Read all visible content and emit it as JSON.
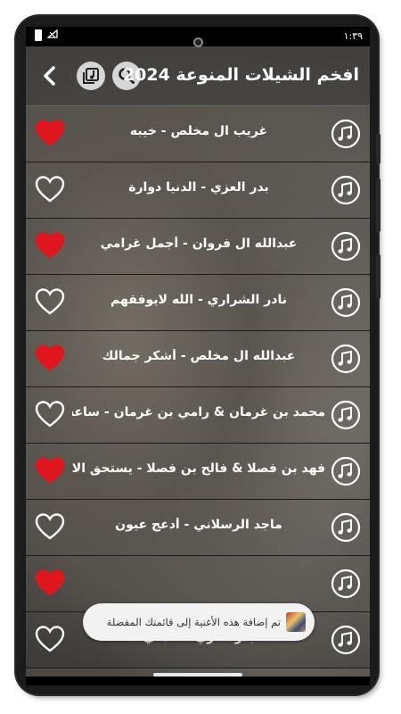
{
  "status": {
    "time": "١:٣٩"
  },
  "header": {
    "title": "افخم الشيلات المنوعة 2024"
  },
  "songs": [
    {
      "title": "غريب ال مخلص - خيبه",
      "favorite": true
    },
    {
      "title": "بدر العزي - الدنيا دوارة",
      "favorite": false
    },
    {
      "title": "عبدالله ال فروان - أجمل غرامي",
      "favorite": true
    },
    {
      "title": "نادر الشراري - الله لايوفقهم",
      "favorite": false
    },
    {
      "title": "عبدالله ال مخلص - أشكر جمالك",
      "favorite": true
    },
    {
      "title": "محمد بن غرمان & رامي بن غرمان - ساعة بس",
      "favorite": false
    },
    {
      "title": "فهد بن فصلا & فالح بن فصلا - يستحق الانتظار",
      "favorite": true
    },
    {
      "title": "ماجد الرسلاني - أدعج عيون",
      "favorite": false
    },
    {
      "title": "",
      "favorite": true
    },
    {
      "title": "بدر العزي - كلمني",
      "favorite": false
    }
  ],
  "toast": {
    "message": "تم إضافة هذه الأغنية إلى قائمتك المفضلة"
  },
  "colors": {
    "heart_filled": "#e0161e",
    "heart_outline": "#ffffff",
    "header_button": "#d6d6d6"
  },
  "icons": {
    "back": "chevron-left-icon",
    "playlist": "music-library-icon",
    "search": "search-icon",
    "song": "music-note-icon"
  }
}
